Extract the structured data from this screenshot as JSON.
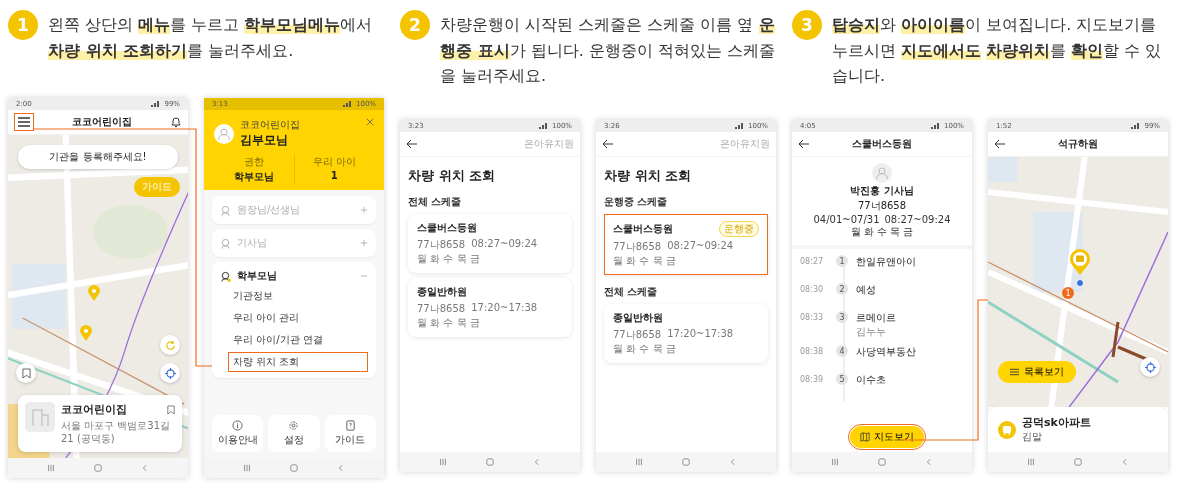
{
  "steps": [
    {
      "number": "1",
      "text": "왼쪽 상단의 **메뉴**를 누르고 **학부모님메뉴**에서 **차량 위치 조회하기**를 눌러주세요.",
      "screens": [
        {
          "kind": "home-map",
          "status": {
            "time": "2:00",
            "battery": "99%"
          },
          "title": "코코어린이집",
          "menu_highlighted": true,
          "banner": "기관을 등록해주세요!",
          "guide_button": "가이드",
          "card": {
            "name": "코코어린이집",
            "address": "서울 마포구 백범로31길 21 (공덕동)"
          }
        },
        {
          "kind": "menu",
          "status": {
            "time": "3:13",
            "battery": "100%"
          },
          "org": "코코어린이집",
          "user": "김부모님",
          "stats": [
            {
              "label": "권한",
              "value": "학부모님"
            },
            {
              "label": "우리 아이",
              "value": "1"
            }
          ],
          "sections": [
            {
              "label": "원장님/선생님",
              "expanded": false
            },
            {
              "label": "기사님",
              "expanded": false
            },
            {
              "label": "학부모님",
              "expanded": true,
              "items": [
                {
                  "label": "기관정보",
                  "highlighted": false
                },
                {
                  "label": "우리 아이 관리",
                  "highlighted": false
                },
                {
                  "label": "우리 아이/기관 연결",
                  "highlighted": false
                },
                {
                  "label": "차량 위치 조회",
                  "highlighted": true
                }
              ]
            }
          ],
          "footer_buttons": [
            "이용안내",
            "설정",
            "가이드"
          ]
        }
      ]
    },
    {
      "number": "2",
      "text": "차량운행이 시작된 스케줄은 스케줄 이름 옆 **운행중 표시**가 됩니다. 운행중이 적혀있는 스케줄을 눌러주세요.",
      "screens": [
        {
          "kind": "schedule-list",
          "status": {
            "time": "3:23",
            "battery": "100%"
          },
          "org": "은아유치원",
          "title": "차량 위치 조회",
          "groups": [
            {
              "title": "전체 스케줄",
              "schedules": [
                {
                  "name": "스쿨버스등원",
                  "plate": "77나8658",
                  "time": "08:27~09:24",
                  "days": "월 화 수 목 금",
                  "highlighted": false
                },
                {
                  "name": "종일반하원",
                  "plate": "77나8658",
                  "time": "17:20~17:38",
                  "days": "월 화 수 목 금",
                  "highlighted": false
                }
              ]
            }
          ]
        },
        {
          "kind": "schedule-list",
          "status": {
            "time": "3:26",
            "battery": "100%"
          },
          "org": "은아유치원",
          "title": "차량 위치 조회",
          "groups": [
            {
              "title": "운행중 스케줄",
              "schedules": [
                {
                  "name": "스쿨버스등원",
                  "badge": "운행중",
                  "plate": "77나8658",
                  "time": "08:27~09:24",
                  "days": "월 화 수 목 금",
                  "highlighted": true
                }
              ]
            },
            {
              "title": "전체 스케줄",
              "schedules": [
                {
                  "name": "종일반하원",
                  "plate": "77나8658",
                  "time": "17:20~17:38",
                  "days": "월 화 수 목 금",
                  "highlighted": false
                }
              ]
            }
          ]
        }
      ]
    },
    {
      "number": "3",
      "text": "**탑승지**와 **아이이름**이 보여집니다. 지도보기를 누르시면 **지도에서도** **차량위치**를 **확인**할 수 있습니다.",
      "screens": [
        {
          "kind": "route",
          "status": {
            "time": "4:05",
            "battery": "100%"
          },
          "title": "스쿨버스등원",
          "driver": "박진홍 기사님",
          "plate": "77너8658",
          "period": "04/01~07/31",
          "time": "08:27~09:24",
          "days": "월 화 수 목 금",
          "stops": [
            {
              "time": "08:27",
              "number": "1",
              "name": "한일유앤아이"
            },
            {
              "time": "08:30",
              "number": "2",
              "name": "예성"
            },
            {
              "time": "08:33",
              "number": "3",
              "name": "르메이르",
              "child": "김누누"
            },
            {
              "time": "08:38",
              "number": "4",
              "name": "사당역부동산"
            },
            {
              "time": "08:39",
              "number": "5",
              "name": "이수초"
            }
          ],
          "map_button": {
            "label": "지도보기",
            "highlighted": true
          }
        },
        {
          "kind": "map-view",
          "status": {
            "time": "1:52",
            "battery": "99%"
          },
          "title": "석규하원",
          "marker": "1",
          "list_button": "목록보기",
          "card": {
            "name": "공덕sk아파트",
            "child": "김말"
          }
        }
      ]
    }
  ]
}
